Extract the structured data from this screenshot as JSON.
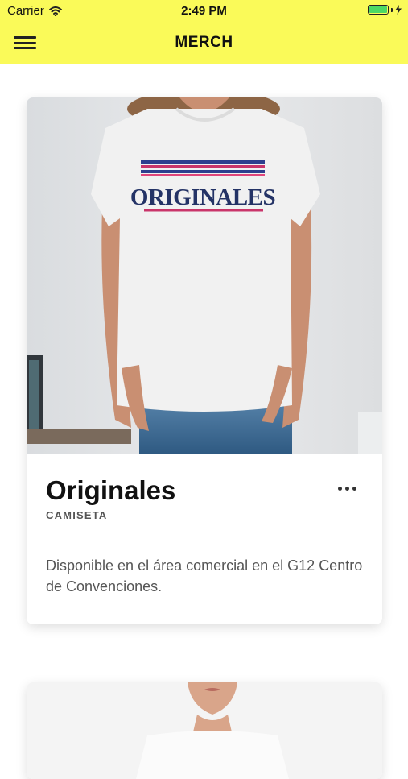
{
  "status_bar": {
    "carrier": "Carrier",
    "time": "2:49 PM",
    "battery_level": 1.0
  },
  "nav_bar": {
    "title": "MERCH",
    "menu_icon": "hamburger-menu-icon",
    "background_color": "#fafa59"
  },
  "cards": [
    {
      "image_text": "ORIGINALES",
      "name": "Originales",
      "category": "CAMISETA",
      "more_icon": "more-horizontal-icon",
      "description": "Disponible en el área comercial en el G12 Centro de Convenciones."
    }
  ]
}
